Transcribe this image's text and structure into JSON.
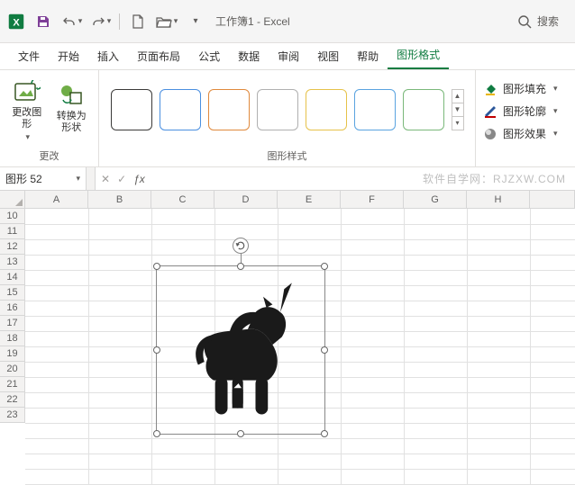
{
  "titlebar": {
    "doc_title": "工作簿1 - Excel",
    "search_label": "搜索"
  },
  "tabs": {
    "file": "文件",
    "home": "开始",
    "insert": "插入",
    "layout": "页面布局",
    "formulas": "公式",
    "data": "数据",
    "review": "审阅",
    "view": "视图",
    "help": "帮助",
    "shape_format": "图形格式"
  },
  "ribbon": {
    "change_group_label": "更改",
    "change_shape_label": "更改图形",
    "convert_label": "转换为形状",
    "styles_group_label": "图形样式",
    "fill_label": "图形填充",
    "outline_label": "图形轮廓",
    "effects_label": "图形效果",
    "style_colors": [
      "#3b3a39",
      "#4a8fe0",
      "#e0893c",
      "#b0b0b0",
      "#e6c24a",
      "#5aa3e0",
      "#7ab87a"
    ]
  },
  "formula_bar": {
    "namebox_value": "图形 52",
    "watermark": "软件自学网：RJZXW.COM"
  },
  "grid": {
    "columns": [
      "A",
      "B",
      "C",
      "D",
      "E",
      "F",
      "G",
      "H"
    ],
    "rows": [
      "10",
      "11",
      "12",
      "13",
      "14",
      "15",
      "16",
      "17",
      "18",
      "19",
      "20",
      "21",
      "22",
      "23"
    ]
  },
  "icons": {
    "save": "save-icon",
    "undo": "undo-icon",
    "redo": "redo-icon",
    "newfile": "new-file-icon",
    "open": "open-folder-icon"
  }
}
